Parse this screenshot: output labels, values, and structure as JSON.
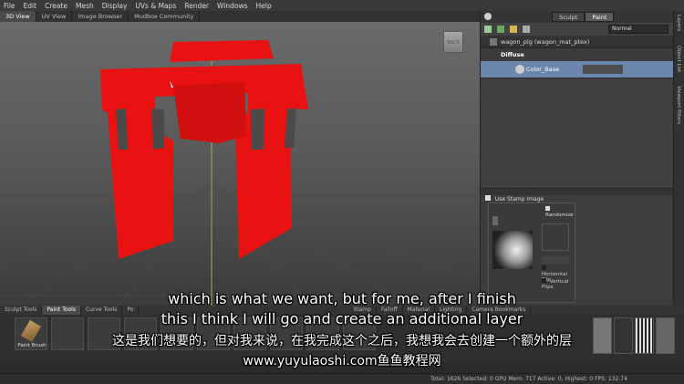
{
  "menu": [
    "File",
    "Edit",
    "Create",
    "Mesh",
    "Display",
    "UVs & Maps",
    "Render",
    "Windows",
    "Help"
  ],
  "view_tabs": [
    "3D View",
    "UV View",
    "Image Browser",
    "Mudbox Community"
  ],
  "right_panel": {
    "tabs": [
      "Sculpt",
      "Paint"
    ],
    "blend_mode": "Normal",
    "layer_group": "wagon_plg (wagon_mat_ptex)",
    "channel": "Diffuse",
    "layer_name": "Color_Base",
    "stamp": {
      "use_stamp_label": "Use Stamp Image",
      "randomize_label": "Randomize",
      "horizontal_flip_label": "Horizontal Flip",
      "vertical_flip_label": "Vertical Flips"
    }
  },
  "side_tabs": [
    "Layers",
    "Object List",
    "Viewport Filters"
  ],
  "shelf_tabs": [
    "Sculpt Tools",
    "Paint Tools",
    "Curve Tools",
    "Po",
    "Stamp",
    "Falloff",
    "Material",
    "Lighting",
    "Camera Bookmarks"
  ],
  "shelf": {
    "tool_label": "Paint Brush"
  },
  "status_text": "Total: 1626  Selected: 0  GPU Mem: 717  Active: 0, Highest: 0  FPS: 132.74",
  "subtitles": {
    "line1": "which is what we want, but for me, after I finish",
    "line2": "this I think I will go and create an additional layer",
    "line3": "这是我们想要的，但对我来说，在我完成这个之后，我想我会去创建一个额外的层",
    "line4": "www.yuyulaoshi.com鱼鱼教程网"
  },
  "colors": {
    "model": "#e81212",
    "selected_layer": "#6b87ac"
  }
}
